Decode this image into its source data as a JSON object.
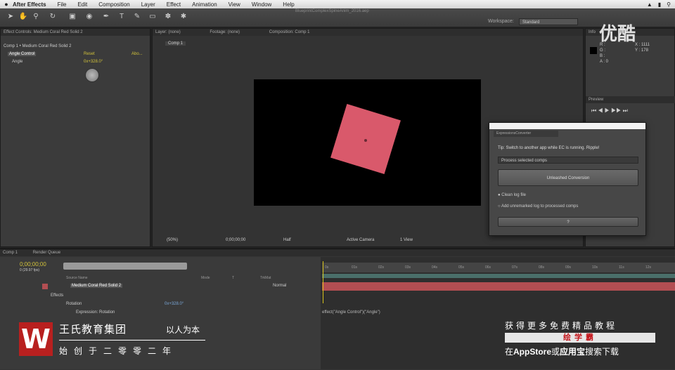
{
  "menubar": {
    "apple": "",
    "items": [
      "After Effects",
      "File",
      "Edit",
      "Composition",
      "Layer",
      "Effect",
      "Animation",
      "View",
      "Window",
      "Help"
    ]
  },
  "document_title": "BlueprintComplexSpineAnim_2016.aep",
  "workspace": {
    "label": "Workspace:",
    "value": "Standard"
  },
  "effect_panel": {
    "tab": "Effect Controls: Medium Coral Red Solid 2",
    "comp_path": "Comp 1 • Medium Coral Red Solid 2",
    "effect_name": "Angle Control",
    "reset": "Reset",
    "about": "Abo...",
    "property": "Angle",
    "property_value": "0x+328.0°"
  },
  "comp_panel": {
    "tabs": [
      "Layer: (none)",
      "Footage: (none)",
      "Composition: Comp 1"
    ],
    "sub_tab": "Comp 1",
    "magnification": "(50%)",
    "timecode": "0;00;00;00",
    "quality": "Half",
    "camera": "Active Camera",
    "views": "1 View"
  },
  "right_panel": {
    "info_tab": "Info",
    "preview_tab": "Preview",
    "info_rgb": [
      "R :",
      "G :",
      "B :",
      "A : 0"
    ],
    "info_coords": [
      "X : 1111",
      "Y : 178"
    ]
  },
  "dialog": {
    "tab": "ExpressionsConverter",
    "tip": "Tip: Switch to another app while EC is running. Ripple!",
    "select": "Process selected comps",
    "button": "Unleashed Conversion",
    "option1": "Clean log file",
    "option2": "Add unremarked log to processed comps",
    "ok": "?"
  },
  "timeline": {
    "tab": "Comp 1",
    "render_queue": "Render Queue",
    "timecode": "0;00;00;00",
    "fps": "0 (29.97 fps)",
    "columns": [
      "Source Name",
      "Mode",
      "T",
      "TrkMat"
    ],
    "layer_name": "Medium Coral Red Solid 2",
    "mode": "Normal",
    "effects": "Effects",
    "transform_prop": "Rotation",
    "rotation_value": "0x+328.0°",
    "expression_label": "Expression: Rotation",
    "expression_text": "effect(\"Angle Control\")(\"Angle\")",
    "ruler_ticks": [
      "0s",
      "01s",
      "02s",
      "03s",
      "04s",
      "05s",
      "06s",
      "07s",
      "08s",
      "09s",
      "10s",
      "11s",
      "12s"
    ]
  },
  "branding": {
    "logo": "W",
    "name": "王氏教育集团",
    "slogan": "以人为本",
    "since": "始创于二零零二年"
  },
  "promo": {
    "top": "获得更多免费精品教程",
    "badge": "绘学霸",
    "bottom_prefix": "在",
    "appstore": "AppStore",
    "or": "或",
    "app": "应用宝",
    "bottom_suffix": "搜索下载"
  },
  "watermark": "优酷",
  "colors": {
    "solid": "#d9596b",
    "layer_bar": "#b24e52",
    "playhead": "#d8c21a",
    "logo": "#b8201f"
  }
}
